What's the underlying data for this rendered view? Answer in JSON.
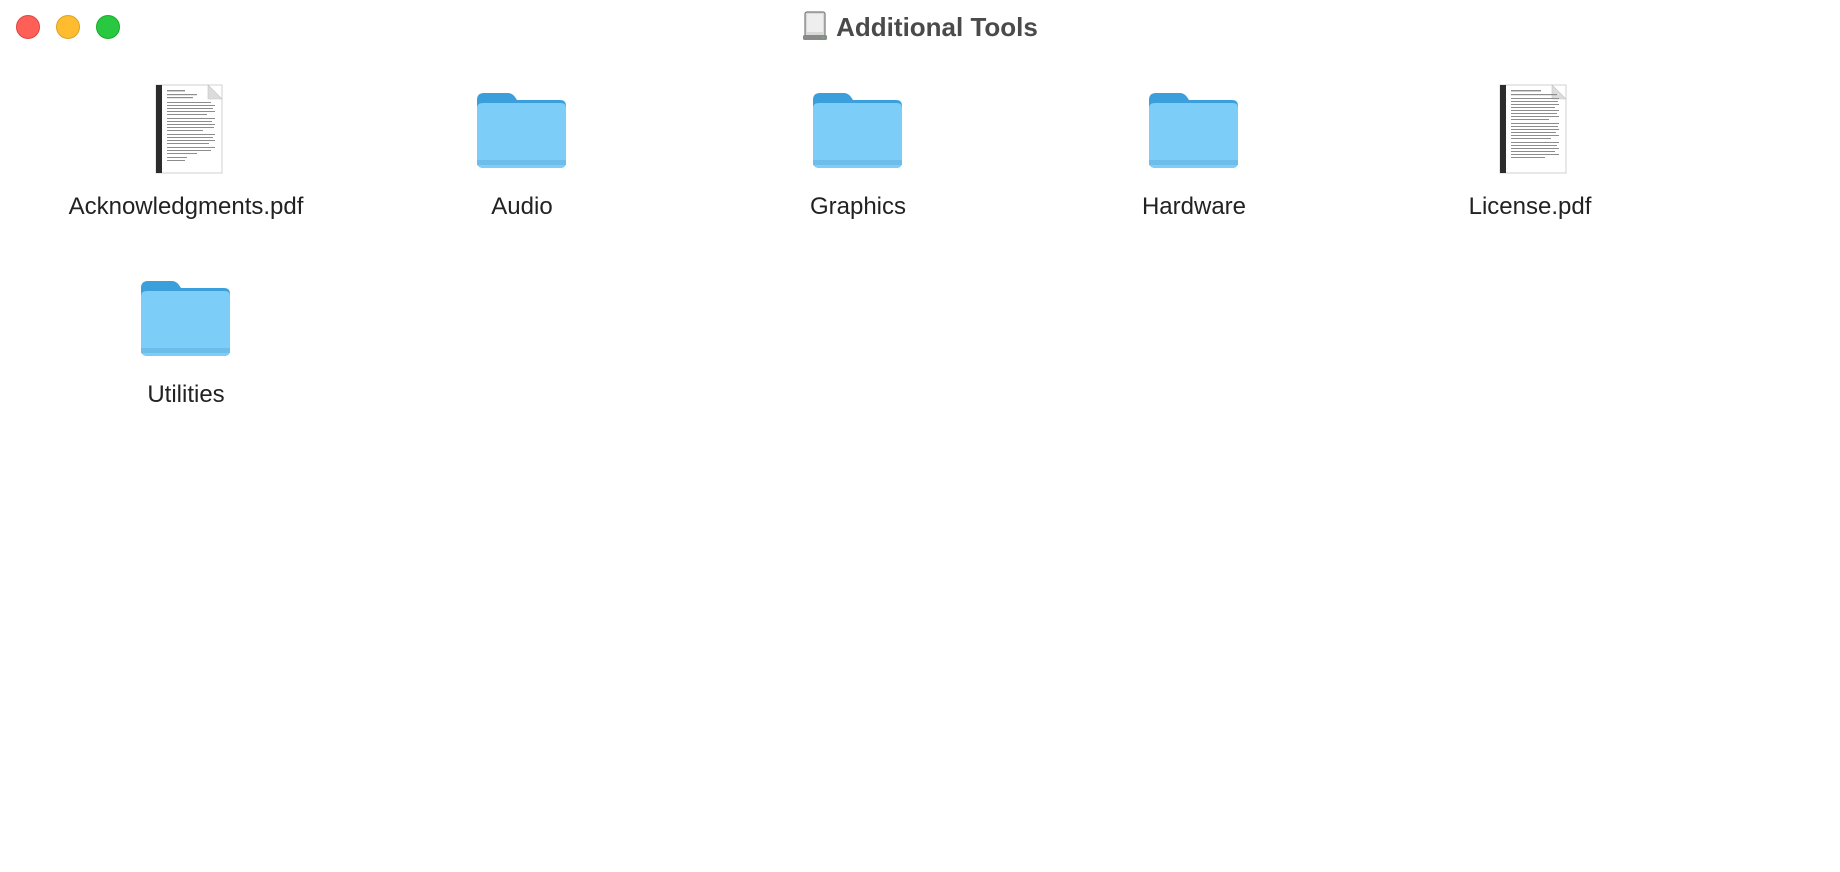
{
  "window": {
    "title": "Additional Tools",
    "title_icon": "disk-image-icon"
  },
  "items": [
    {
      "label": "Acknowledgments.pdf",
      "kind": "pdf",
      "icon": "pdf-document-icon"
    },
    {
      "label": "Audio",
      "kind": "folder",
      "icon": "folder-icon"
    },
    {
      "label": "Graphics",
      "kind": "folder",
      "icon": "folder-icon"
    },
    {
      "label": "Hardware",
      "kind": "folder",
      "icon": "folder-icon"
    },
    {
      "label": "License.pdf",
      "kind": "pdf",
      "icon": "pdf-document-icon"
    },
    {
      "label": "Utilities",
      "kind": "folder",
      "icon": "folder-icon"
    }
  ],
  "colors": {
    "folder_body": "#7ccdf7",
    "folder_tab": "#3b9fdc",
    "close": "#fe5f57",
    "minimize": "#febc2e",
    "zoom": "#28c840"
  }
}
